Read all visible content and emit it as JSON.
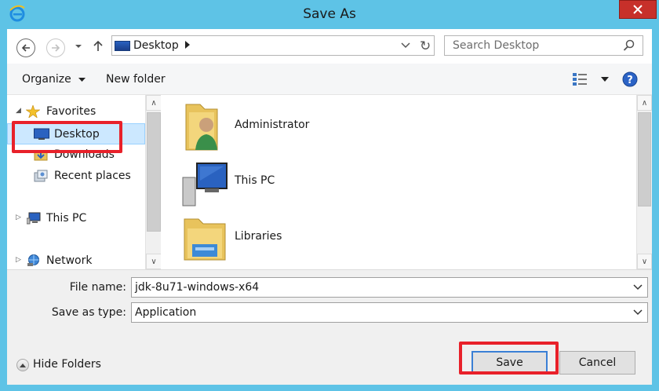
{
  "window": {
    "title": "Save As"
  },
  "nav": {
    "location": "Desktop",
    "search_placeholder": "Search Desktop"
  },
  "toolbar": {
    "organize": "Organize",
    "new_folder": "New folder"
  },
  "sidebar": {
    "items": [
      {
        "label": "Favorites",
        "icon": "star-icon"
      },
      {
        "label": "Desktop",
        "icon": "desktop-icon",
        "selected": true
      },
      {
        "label": "Downloads",
        "icon": "downloads-icon"
      },
      {
        "label": "Recent places",
        "icon": "recent-places-icon"
      },
      {
        "label": "This PC",
        "icon": "computer-icon"
      },
      {
        "label": "Network",
        "icon": "network-icon"
      }
    ]
  },
  "files": [
    {
      "name": "Administrator",
      "icon": "user-folder-icon"
    },
    {
      "name": "This PC",
      "icon": "computer-icon"
    },
    {
      "name": "Libraries",
      "icon": "libraries-folder-icon"
    }
  ],
  "form": {
    "file_name_label": "File name:",
    "file_name_value": "jdk-8u71-windows-x64",
    "save_type_label": "Save as type:",
    "save_type_value": "Application"
  },
  "footer": {
    "hide_folders": "Hide Folders",
    "save_label": "Save",
    "cancel_label": "Cancel"
  },
  "colors": {
    "frame": "#5ec3e6",
    "close_button": "#c7302a",
    "selection": "#cce8ff",
    "highlight": "#e8212a"
  }
}
